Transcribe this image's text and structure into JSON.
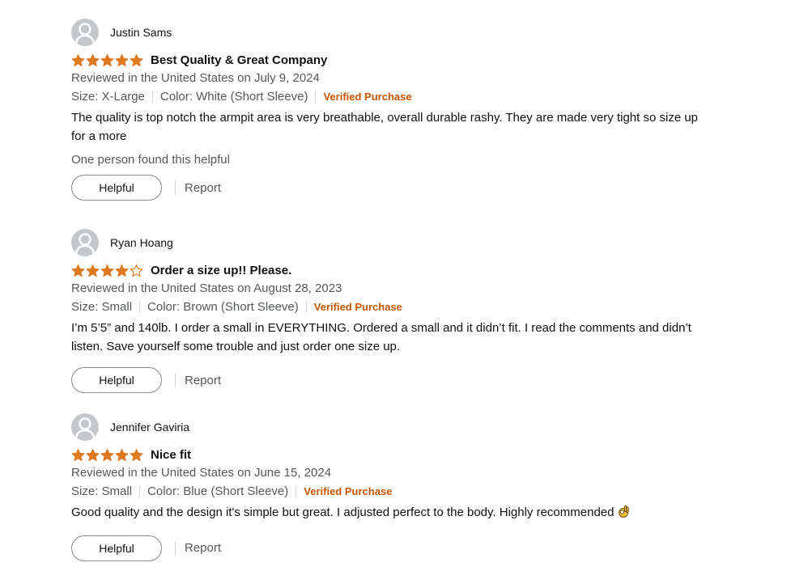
{
  "colors": {
    "star": "#de7921",
    "verified": "#c45500",
    "muted_text": "#565959",
    "text": "#0f1111",
    "button_border": "#888c8c"
  },
  "icons": {
    "avatar": "default-user-avatar-icon",
    "star_full": "star-filled-icon",
    "star_empty": "star-outline-icon",
    "ok_hand": "ok-hand-emoji-icon"
  },
  "reviews": [
    {
      "author": "Justin Sams",
      "rating": 5,
      "title": "Best Quality & Great Company",
      "date": "Reviewed in the United States on July 9, 2024",
      "size": "Size: X-Large",
      "color": "Color: White (Short Sleeve)",
      "verified": "Verified Purchase",
      "body": "The quality is top notch the armpit area is very breathable, overall durable rashy. They are made very tight so size up for a more",
      "helpful_count": "One person found this helpful",
      "helpful_label": "Helpful",
      "report_label": "Report"
    },
    {
      "author": "Ryan Hoang",
      "rating": 4,
      "title": "Order a size up!! Please.",
      "date": "Reviewed in the United States on August 28, 2023",
      "size": "Size: Small",
      "color": "Color: Brown (Short Sleeve)",
      "verified": "Verified Purchase",
      "body": "I’m 5’5” and 140lb. I order a small in EVERYTHING. Ordered a small and it didn’t fit. I read the comments and didn’t listen. Save yourself some trouble and just order one size up.",
      "helpful_label": "Helpful",
      "report_label": "Report"
    },
    {
      "author": "Jennifer Gaviria",
      "rating": 5,
      "title": "Nice fit",
      "date": "Reviewed in the United States on June 15, 2024",
      "size": "Size: Small",
      "color": "Color: Blue (Short Sleeve)",
      "verified": "Verified Purchase",
      "body": "Good quality and the design it's simple but great. I adjusted perfect to the body. Highly recommended",
      "helpful_label": "Helpful",
      "report_label": "Report"
    }
  ]
}
